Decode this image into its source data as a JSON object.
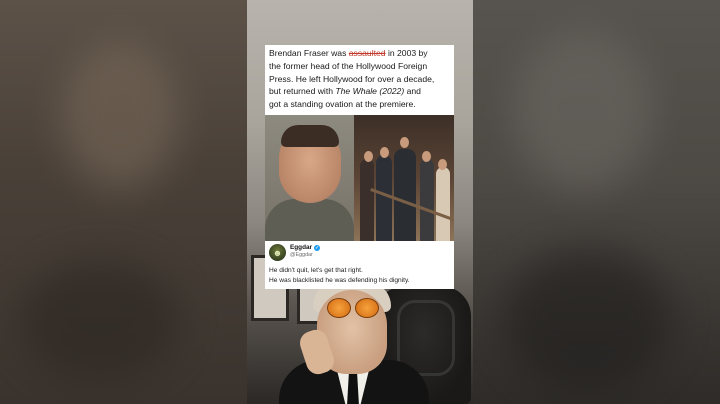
{
  "article": {
    "line1_pre": "Brendan Fraser was ",
    "line1_strike": "assaulted",
    "line1_post": " in 2003 by",
    "line2": "the former head of the Hollywood Foreign",
    "line3": "Press. He left Hollywood for over a decade,",
    "line4_pre": "but returned with ",
    "line4_em": "The Whale (2022)",
    "line4_post": " and",
    "line5": "got a standing ovation at the premiere."
  },
  "tweet": {
    "name": "Eggdar",
    "handle": "@Eggdar",
    "verified_glyph": "✓",
    "line1": "He didn't quit, let's get that right.",
    "line2": "He was blacklisted he was defending his dignity."
  },
  "colors": {
    "strike": "#c0392b",
    "verified": "#1d9bf0"
  }
}
